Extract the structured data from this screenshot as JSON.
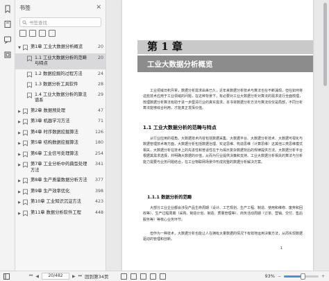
{
  "panel": {
    "title": "书签",
    "close": "✕",
    "search_placeholder": "书签查找"
  },
  "bookmarks": [
    {
      "label": "第1章 工业大数据分析概览",
      "page": "20",
      "level": 0,
      "expanded": true
    },
    {
      "label": "1.1 工业大数据分析的范畴与特点",
      "page": "20",
      "level": 1,
      "selected": true
    },
    {
      "label": "1.2 数据挖掘的过程方法",
      "page": "24",
      "level": 1
    },
    {
      "label": "1.3 数据分析工具软件",
      "page": "28",
      "level": 1
    },
    {
      "label": "1.4 工业大数据分析的算法谱系",
      "page": "29",
      "level": 1
    },
    {
      "label": "第2章 数据预处理",
      "page": "47",
      "level": 0
    },
    {
      "label": "第3章 机器学习方法",
      "page": "71",
      "level": 0
    },
    {
      "label": "第4章 时序数据挖掘算法",
      "page": "126",
      "level": 0
    },
    {
      "label": "第5章 结构数据挖掘算法",
      "page": "180",
      "level": 0
    },
    {
      "label": "第6章 工业信号处理算法",
      "page": "254",
      "level": 0
    },
    {
      "label": "第7章 工业分析中的典型处理方法",
      "page": "341",
      "level": 0
    },
    {
      "label": "第8章 生产质量数据分析方法",
      "page": "377",
      "level": 0
    },
    {
      "label": "第9章 生产效率优化",
      "page": "398",
      "level": 0
    },
    {
      "label": "第10章 工业知识沉淀方法",
      "page": "423",
      "level": 0
    },
    {
      "label": "第11章 数据分析软件工程",
      "page": "448",
      "level": 0
    }
  ],
  "page": {
    "chapter_number": "第 1 章",
    "chapter_title": "工业大数据分析概览",
    "intro": "工业领域日积月累，数据分析需求由来已久，近年来数据分析技术与算法也在不断涌现。但在如何将这些技术应用于工业领域的问题，在这种背景下，有必要对工业大数据分析对算法的需求进行全面梳理，梳理数据分析算法有助于进一步厘清行业的真实需求。本书将数据分析方法与算法仅仅是局部，不同分析算法能够综合利用，才能真正发挥价值。",
    "section1": "1.1 工业大数据分析的范畴与特点",
    "para1": "从行业应用的视角，大数据技术内容包括数据采集、大数据平台、大数据分析技术、大数据可视化与数据管理技术等方面，大数据分析包括数据治理、实证思维、构造思维（计算思维）这其他三类思维模式相关，大数据分析在技术上的先进性和普适性在于为揭示复杂数据背后的规律提供方法。大数据分析平台根据其需求选择，并明确大数据的价值，从而为行业提供决策和支持。工业大数据分析相关的算法与分析能力需要与业务问题结合，在工业物联网场景中形成完整的数据分析解决方案。",
    "section2": "1.1.1 数据分析的范畴",
    "para2": "大部分工业企业都会涉及产品生命周期（设计、工艺规划、生产工程、制造、使用和维修、废弃和回收等）、生产过程周期（采购、制造计划、制造、质量管理等）、商务活动周期（订单、营销、交付、售后服务等）等核心业务环节。",
    "para3": "但作为一种技术，大数据分析也能让人在拥有大量数据的情况下有效地运用决策方法，从而实现数据驱动的管理和创新。",
    "page_number": "1"
  },
  "status": {
    "page_input": "20/482",
    "goto_label": "回到第34页",
    "zoom": "93%",
    "zoom_fraction": 0.55
  }
}
